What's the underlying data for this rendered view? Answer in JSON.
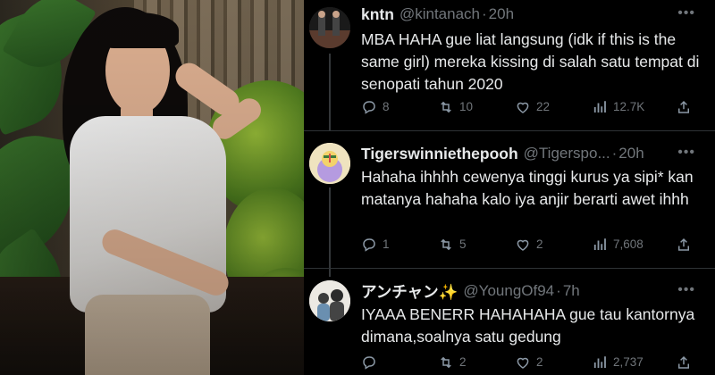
{
  "tweets": [
    {
      "name": "kntn",
      "handle": "@kintanach",
      "time": "20h",
      "text": "MBA HAHA gue liat langsung (idk if this is the same girl) mereka kissing di salah satu tempat di senopati tahun 2020",
      "replies": "8",
      "retweets": "10",
      "likes": "22",
      "views": "12.7K"
    },
    {
      "name": "Tigerswinniethepooh",
      "handle": "@Tigerspo...",
      "time": "20h",
      "text": "Hahaha ihhhh cewenya tinggi kurus ya sipi* kan matanya hahaha kalo iya anjir berarti awet ihhh",
      "replies": "1",
      "retweets": "5",
      "likes": "2",
      "views": "7,608"
    },
    {
      "name": "アンチャン✨",
      "handle": "@YoungOf94",
      "time": "7h",
      "text": "IYAAA BENERR HAHAHAHA gue tau kantornya dimana,soalnya satu gedung",
      "replies": "",
      "retweets": "2",
      "likes": "2",
      "views": "2,737"
    }
  ],
  "ui": {
    "dot": "·",
    "more": "•••"
  },
  "icons": [
    "reply-icon",
    "retweet-icon",
    "like-icon",
    "views-icon",
    "share-icon"
  ]
}
